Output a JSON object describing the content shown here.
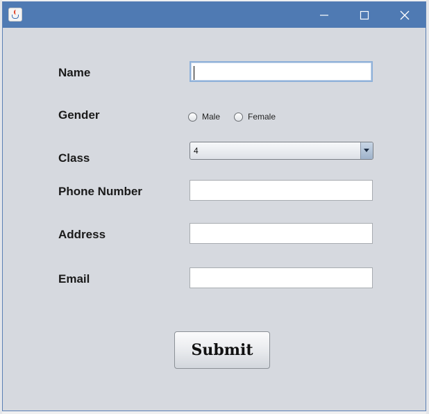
{
  "window": {
    "icon": "java-coffee-cup-icon",
    "controls": [
      "minimize-icon",
      "maximize-icon",
      "close-icon"
    ]
  },
  "form": {
    "name_label": "Name",
    "name_value": "",
    "gender_label": "Gender",
    "gender_options": [
      "Male",
      "Female"
    ],
    "gender_selected": null,
    "class_label": "Class",
    "class_value": "4",
    "phone_label": "Phone Number",
    "phone_value": "",
    "address_label": "Address",
    "address_value": "",
    "email_label": "Email",
    "email_value": "",
    "submit_label": "Submit"
  },
  "colors": {
    "titlebar": "#4f7ab3",
    "window_background": "#d6d9df",
    "field_background": "#ffffff"
  }
}
